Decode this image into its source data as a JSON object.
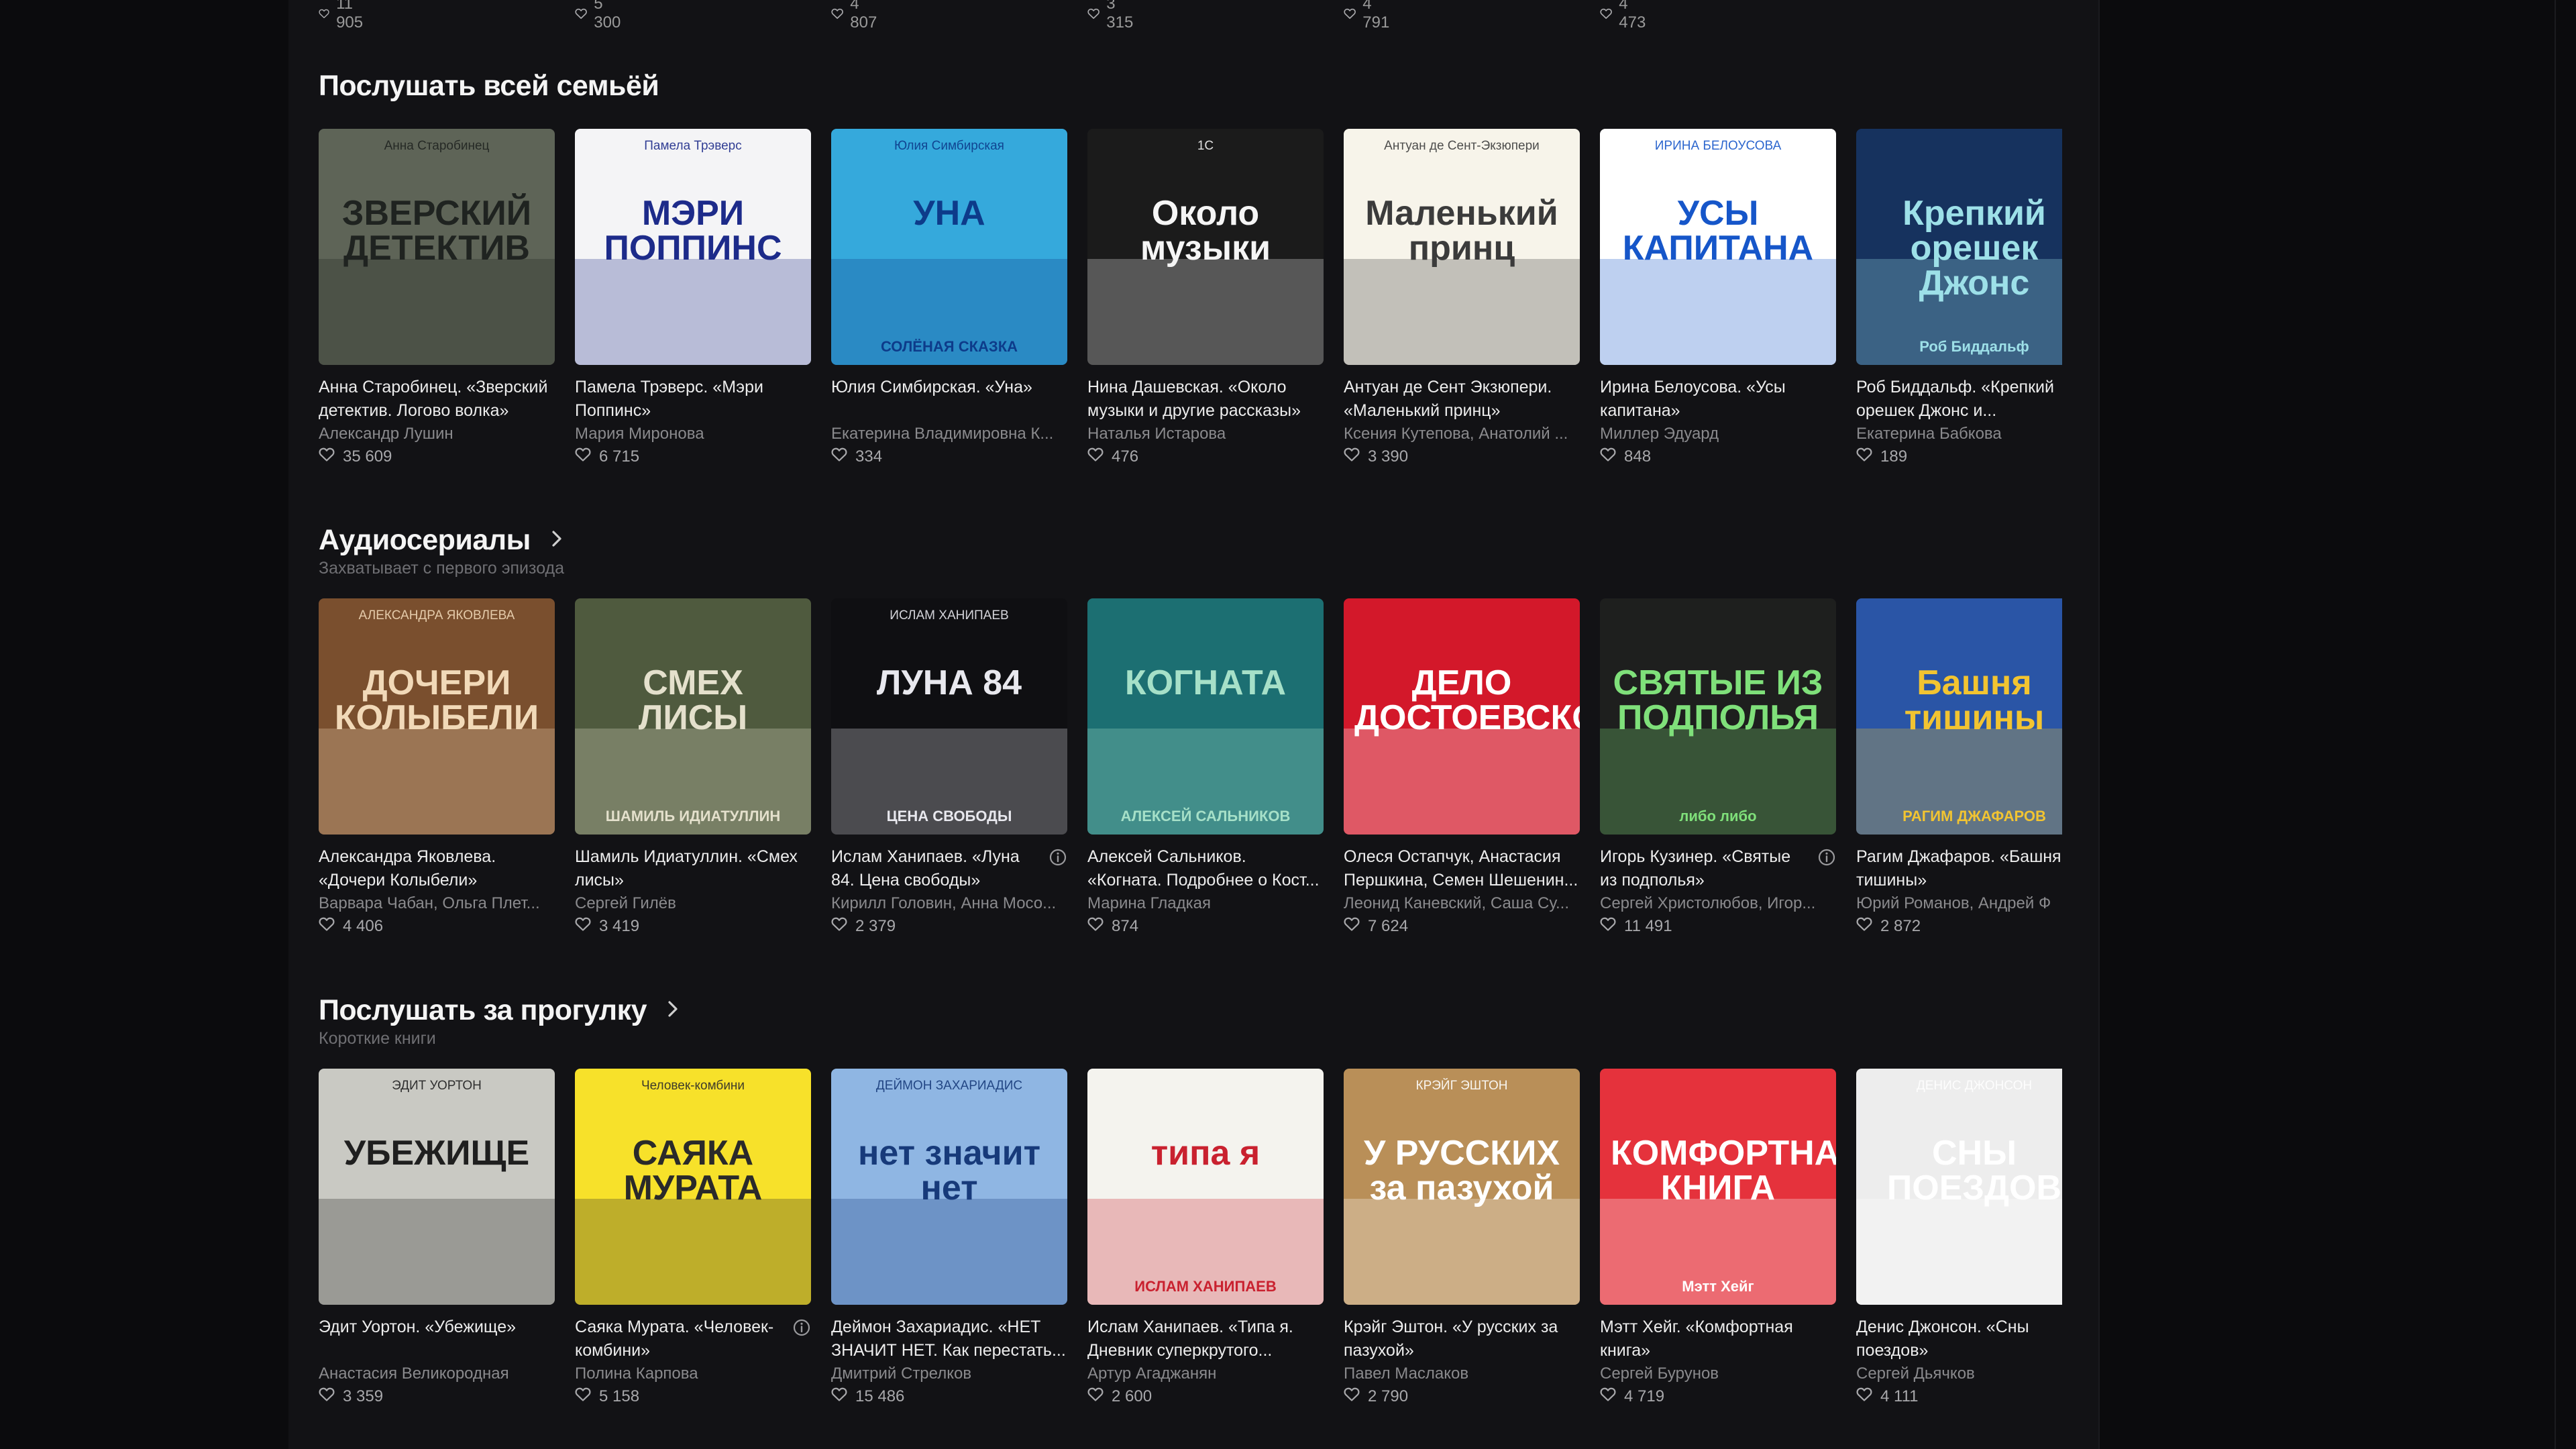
{
  "top_likes": [
    "11 905",
    "5 300",
    "4 807",
    "3 315",
    "4 791",
    "4 473"
  ],
  "sections": [
    {
      "title": "Послушать всей семьёй",
      "subtitle": "",
      "has_arrow": false,
      "cards": [
        {
          "title": "Анна Старобинец. «Зверский детектив. Логово волка»",
          "author": "Александр Лушин",
          "likes": "35 609",
          "cover_text": "ЗВЕРСКИЙ ДЕТЕКТИВ",
          "cover_top": "Анна Старобинец",
          "bg": "#5e6457",
          "fg": "#1f2320"
        },
        {
          "title": "Памела Трэверс. «Мэри Поппинс»",
          "author": "Мария Миронова",
          "likes": "6 715",
          "cover_text": "МЭРИ ПОППИНС",
          "cover_top": "Памела Трэверс",
          "bg": "#f4f4f6",
          "fg": "#1d2b8a"
        },
        {
          "title": "Юлия Симбирская. «Уна»",
          "author": "Екатерина Владимировна К...",
          "likes": "334",
          "cover_text": "УНА",
          "cover_top": "Юлия Симбирская",
          "cover_bottom": "СОЛЁНАЯ СКАЗКА",
          "bg": "#35a9dc",
          "fg": "#0d3b8a"
        },
        {
          "title": "Нина Дашевская. «Около музыки и другие рассказы»",
          "author": "Наталья Истарова",
          "likes": "476",
          "cover_text": "Около музыки",
          "cover_top": "1С",
          "bg": "#1b1b1b",
          "fg": "#f5f5f5"
        },
        {
          "title": "Антуан де Сент Экзюпери. «Маленький принц»",
          "author": "Ксения Кутепова, Анатолий ...",
          "likes": "3 390",
          "cover_text": "Маленький принц",
          "cover_top": "Антуан де Сент-Экзюпери",
          "bg": "#f7f4ea",
          "fg": "#3b3b3b"
        },
        {
          "title": "Ирина Белоусова. «Усы капитана»",
          "author": "Миллер Эдуард",
          "likes": "848",
          "cover_text": "УСЫ КАПИТАНА",
          "cover_top": "ИРИНА БЕЛОУСОВА",
          "bg": "#ffffff",
          "fg": "#1656c9"
        },
        {
          "title": "Роб Биддальф. «Крепкий орешек Джонс и...",
          "author": "Екатерина Бабкова",
          "likes": "189",
          "cover_text": "Крепкий орешек Джонс",
          "cover_top": "",
          "cover_bottom": "Роб Биддальф",
          "bg": "#16325e",
          "fg": "#9de0e8"
        }
      ]
    },
    {
      "title": "Аудиосериалы",
      "subtitle": "Захватывает с первого эпизода",
      "has_arrow": true,
      "cards": [
        {
          "title": "Александра Яковлева. «Дочери Колыбели»",
          "author": "Варвара Чабан, Ольга Плет...",
          "likes": "4 406",
          "cover_text": "ДОЧЕРИ КОЛЫБЕЛИ",
          "cover_top": "АЛЕКСАНДРА ЯКОВЛЕВА",
          "bg": "#7a4f2e",
          "fg": "#f1d9b8"
        },
        {
          "title": "Шамиль Идиатуллин. «Смех лисы»",
          "author": "Сергей Гилёв",
          "likes": "3 419",
          "cover_text": "СМЕХ ЛИСЫ",
          "cover_top": "",
          "cover_bottom": "ШАМИЛЬ ИДИАТУЛЛИН",
          "bg": "#4f5a3e",
          "fg": "#e4e0cc"
        },
        {
          "title": "Ислам Ханипаев. «Луна 84. Цена свободы»",
          "author": "Кирилл Головин, Анна Мосо...",
          "likes": "2 379",
          "cover_text": "ЛУНА 84",
          "cover_top": "ИСЛАМ ХАНИПАЕВ",
          "cover_bottom": "ЦЕНА СВОБОДЫ",
          "bg": "#0f0f12",
          "fg": "#e8e8ee",
          "info": true
        },
        {
          "title": "Алексей Сальников. «Когната. Подробнее о Кост...",
          "author": "Марина Гладкая",
          "likes": "874",
          "cover_text": "КОГНАТА",
          "cover_top": "",
          "cover_bottom": "АЛЕКСЕЙ САЛЬНИКОВ",
          "bg": "#1c6f72",
          "fg": "#a6e0c8"
        },
        {
          "title": "Олеся Остапчук, Анастасия Першкина, Семен Шешенин...",
          "author": "Леонид Каневский, Саша Су...",
          "likes": "7 624",
          "cover_text": "ДЕЛО ДОСТОЕВСКОГО",
          "cover_top": "",
          "bg": "#d3182a",
          "fg": "#ffffff"
        },
        {
          "title": "Игорь Кузинер. «Святые из подполья»",
          "author": "Сергей Христолюбов, Игор...",
          "likes": "11 491",
          "cover_text": "СВЯТЫЕ ИЗ ПОДПОЛЬЯ",
          "cover_top": "",
          "cover_bottom": "либо либо",
          "bg": "#1e1f1e",
          "fg": "#7fe07a",
          "info": true
        },
        {
          "title": "Рагим Джафаров. «Башня тишины»",
          "author": "Юрий Романов, Андрей Ф",
          "likes": "2 872",
          "cover_text": "Башня тишины",
          "cover_top": "",
          "cover_bottom": "РАГИМ ДЖАФАРОВ",
          "bg": "#2a55a6",
          "fg": "#f2c431"
        }
      ]
    },
    {
      "title": "Послушать за прогулку",
      "subtitle": "Короткие книги",
      "has_arrow": true,
      "cards": [
        {
          "title": "Эдит Уортон. «Убежище»",
          "author": "Анастасия Великородная",
          "likes": "3 359",
          "cover_text": "УБЕЖИЩЕ",
          "cover_top": "ЭДИТ УОРТОН",
          "bg": "#c9c9c3",
          "fg": "#1f1f1f"
        },
        {
          "title": "Саяка Мурата. «Человек-комбини»",
          "author": "Полина Карпова",
          "likes": "5 158",
          "cover_text": "САЯКА МУРАТА",
          "cover_top": "Человек-комбини",
          "bg": "#f7e12a",
          "fg": "#2a2a2a",
          "info": true
        },
        {
          "title": "Деймон Захариадис. «НЕТ ЗНАЧИТ НЕТ. Как перестать...",
          "author": "Дмитрий Стрелков",
          "likes": "15 486",
          "cover_text": "нет значит нет",
          "cover_top": "ДЕЙМОН ЗАХАРИАДИС",
          "bg": "#8fb6e3",
          "fg": "#173a7a"
        },
        {
          "title": "Ислам Ханипаев. «Типа я. Дневник суперкрутого...",
          "author": "Артур Агаджанян",
          "likes": "2 600",
          "cover_text": "типа я",
          "cover_top": "",
          "cover_bottom": "ИСЛАМ ХАНИПАЕВ",
          "bg": "#f4f3ee",
          "fg": "#c9212f"
        },
        {
          "title": "Крэйг Эштон. «У русских за пазухой»",
          "author": "Павел Маслаков",
          "likes": "2 790",
          "cover_text": "У РУССКИХ за пазухой",
          "cover_top": "КРЭЙГ ЭШТОН",
          "bg": "#b98f58",
          "fg": "#ffffff"
        },
        {
          "title": "Мэтт Хейг. «Комфортная книга»",
          "author": "Сергей Бурунов",
          "likes": "4 719",
          "cover_text": "КОМФОРТНАЯ КНИГА",
          "cover_top": "",
          "cover_bottom": "Мэтт Хейг",
          "bg": "#e5323c",
          "fg": "#ffffff"
        },
        {
          "title": "Денис Джонсон. «Сны поездов»",
          "author": "Сергей Дьячков",
          "likes": "4 111",
          "cover_text": "СНЫ ПОЕЗДОВ",
          "cover_top": "ДЕНИС ДЖОНСОН",
          "bg": "#ededed",
          "fg": "#ffffff"
        }
      ]
    }
  ]
}
